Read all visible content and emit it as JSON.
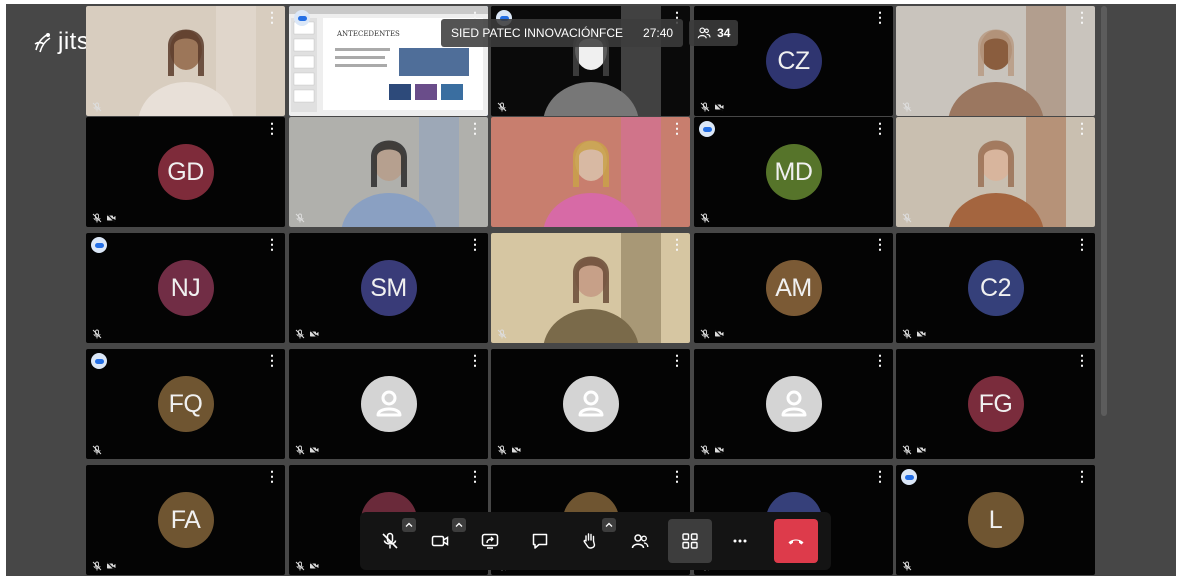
{
  "app": {
    "logo_text": "jitsi"
  },
  "meeting": {
    "subject": "SIED PATEC INNOVACIÓNFCE",
    "timer": "27:40",
    "participant_count": "34"
  },
  "colors": {
    "background": "#474747",
    "tile": "#040404",
    "selected_border": "#246fe5",
    "hangup": "#dd3b4b",
    "toolbar": "#141414"
  },
  "tiles": [
    {
      "type": "video",
      "moderator": false,
      "muted": true,
      "camera_off": false
    },
    {
      "type": "screenshare",
      "moderator": true,
      "selected": true,
      "slide_title": "ANTECEDENTES"
    },
    {
      "type": "video",
      "moderator": true,
      "muted": true,
      "camera_off": false
    },
    {
      "type": "avatar",
      "initials": "CZ",
      "color": "#2f3570",
      "moderator": false,
      "muted": true,
      "camera_off": true
    },
    {
      "type": "video",
      "moderator": false,
      "muted": true,
      "camera_off": false
    },
    {
      "type": "avatar",
      "initials": "GD",
      "color": "#7e2b3a",
      "moderator": false,
      "muted": true,
      "camera_off": true
    },
    {
      "type": "video",
      "moderator": false,
      "muted": true,
      "camera_off": false
    },
    {
      "type": "video",
      "moderator": false,
      "muted": false,
      "camera_off": false
    },
    {
      "type": "avatar",
      "initials": "MD",
      "color": "#56742a",
      "moderator": true,
      "muted": true,
      "camera_off": false
    },
    {
      "type": "video",
      "moderator": false,
      "muted": true,
      "camera_off": false
    },
    {
      "type": "avatar",
      "initials": "NJ",
      "color": "#712d45",
      "moderator": true,
      "muted": true,
      "camera_off": false
    },
    {
      "type": "avatar",
      "initials": "SM",
      "color": "#393b78",
      "moderator": false,
      "muted": true,
      "camera_off": true
    },
    {
      "type": "video",
      "moderator": false,
      "muted": true,
      "camera_off": false
    },
    {
      "type": "avatar",
      "initials": "AM",
      "color": "#7b5a35",
      "moderator": false,
      "muted": true,
      "camera_off": true
    },
    {
      "type": "avatar",
      "initials": "C2",
      "color": "#35407a",
      "moderator": false,
      "muted": true,
      "camera_off": true
    },
    {
      "type": "avatar",
      "initials": "FQ",
      "color": "#6f5531",
      "moderator": true,
      "muted": true,
      "camera_off": false
    },
    {
      "type": "generic",
      "moderator": false,
      "muted": true,
      "camera_off": true
    },
    {
      "type": "generic",
      "moderator": false,
      "muted": true,
      "camera_off": true
    },
    {
      "type": "generic",
      "moderator": false,
      "muted": true,
      "camera_off": true
    },
    {
      "type": "avatar",
      "initials": "FG",
      "color": "#7a2c3c",
      "moderator": false,
      "muted": true,
      "camera_off": true
    },
    {
      "type": "avatar",
      "initials": "FA",
      "color": "#6f5531",
      "moderator": false,
      "muted": true,
      "camera_off": true
    },
    {
      "type": "avatar",
      "initials": "",
      "color": "#6a2a3a",
      "moderator": false,
      "muted": true,
      "camera_off": true
    },
    {
      "type": "avatar",
      "initials": "",
      "color": "#6f5531",
      "moderator": false,
      "muted": true,
      "camera_off": true
    },
    {
      "type": "avatar",
      "initials": "",
      "color": "#36407a",
      "moderator": false,
      "muted": true,
      "camera_off": true
    },
    {
      "type": "avatar",
      "initials": "L",
      "color": "#6f5531",
      "moderator": true,
      "muted": true,
      "camera_off": false
    }
  ],
  "toolbar": {
    "buttons": [
      {
        "name": "microphone",
        "icon": "mic-off-icon",
        "caret": true
      },
      {
        "name": "camera",
        "icon": "camera-icon",
        "caret": true
      },
      {
        "name": "screenshare",
        "icon": "screen-share-icon",
        "caret": false
      },
      {
        "name": "chat",
        "icon": "chat-icon",
        "caret": false
      },
      {
        "name": "raise-hand",
        "icon": "hand-icon",
        "caret": true
      },
      {
        "name": "participants",
        "icon": "participants-icon",
        "caret": false
      },
      {
        "name": "tile-view",
        "icon": "grid-icon",
        "caret": false,
        "active": true
      },
      {
        "name": "more",
        "icon": "more-icon",
        "caret": false
      },
      {
        "name": "hangup",
        "icon": "phone-hangup-icon",
        "caret": false
      }
    ]
  }
}
